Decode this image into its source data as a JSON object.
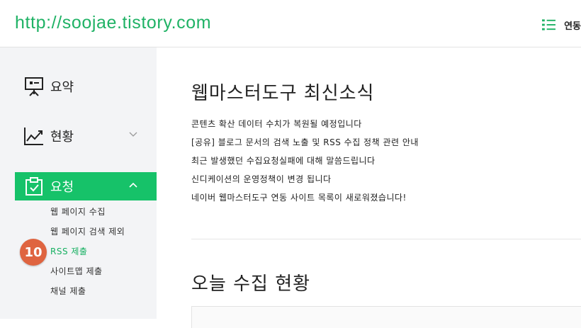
{
  "header": {
    "site_url": "http://soojae.tistory.com",
    "menu_label": "연동"
  },
  "sidebar": {
    "items": [
      {
        "label": "요약",
        "icon": "presentation-board-icon"
      },
      {
        "label": "현황",
        "icon": "line-chart-icon"
      },
      {
        "label": "요청",
        "icon": "clipboard-check-icon"
      }
    ],
    "sub_items": [
      {
        "label": "웹 페이지 수집"
      },
      {
        "label": "웹 페이지 검색 제외"
      },
      {
        "label": "RSS 제출"
      },
      {
        "label": "사이트맵 제출"
      },
      {
        "label": "채널 제출"
      }
    ],
    "badge": "10"
  },
  "main": {
    "news_title": "웹마스터도구 최신소식",
    "news": [
      "콘텐츠 확산 데이터 수치가 복원될 예정입니다",
      "[공유] 블로그 문서의 검색 노출 및 RSS 수집 정책 관련 안내",
      "최근 발생했던 수집요청실패에 대해 말씀드립니다",
      "신디케이션의 운영정책이 변경 됩니다",
      "네이버 웹마스터도구 연동 사이트 목록이 새로워졌습니다!"
    ],
    "stats_title": "오늘 수집 현황"
  },
  "colors": {
    "accent_green": "#16c269",
    "url_green": "#1fb265",
    "badge_orange": "#df6440",
    "sidebar_bg": "#f3f4f6"
  }
}
